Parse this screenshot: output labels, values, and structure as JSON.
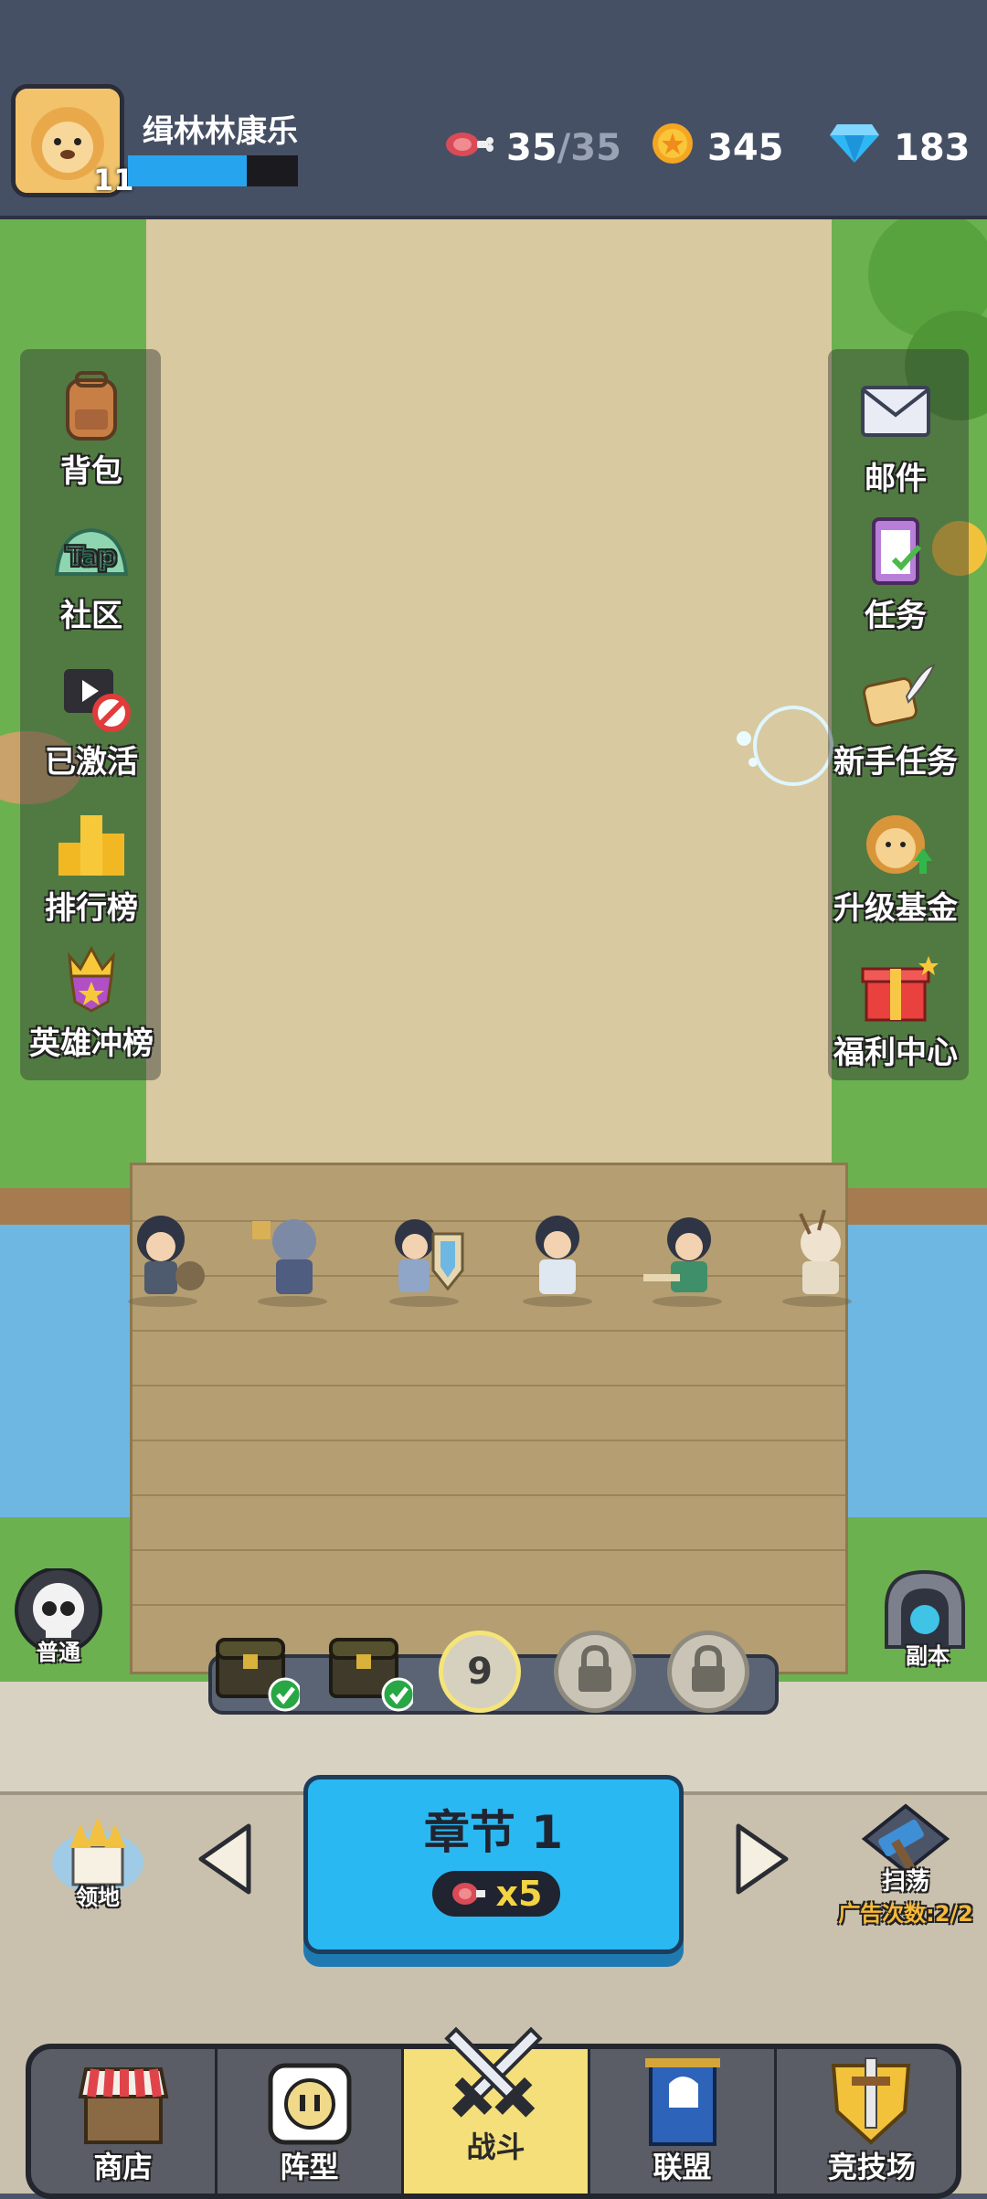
{
  "player": {
    "name": "缉林林康乐",
    "level": "11",
    "xp_fraction": 0.7
  },
  "resources": {
    "stamina": {
      "current": "35",
      "separator": "/",
      "max": "35",
      "icon": "meat-icon"
    },
    "gold": {
      "value": "345",
      "icon": "gold-coin-icon"
    },
    "gems": {
      "value": "183",
      "icon": "diamond-icon"
    }
  },
  "left_menu": [
    {
      "label": "背包",
      "icon": "backpack-icon"
    },
    {
      "label": "社区",
      "icon": "tap-community-icon",
      "icon_text": "Tap"
    },
    {
      "label": "已激活",
      "icon": "video-blocked-icon"
    },
    {
      "label": "排行榜",
      "icon": "ranking-podium-icon"
    },
    {
      "label": "英雄冲榜",
      "icon": "crown-badge-icon"
    }
  ],
  "right_menu": [
    {
      "label": "邮件",
      "icon": "mail-icon"
    },
    {
      "label": "任务",
      "icon": "task-clipboard-icon"
    },
    {
      "label": "新手任务",
      "icon": "scroll-quill-icon"
    },
    {
      "label": "升级基金",
      "icon": "lion-fund-icon"
    },
    {
      "label": "福利中心",
      "icon": "gift-box-icon"
    }
  ],
  "difficulty": {
    "label": "普通",
    "icon": "skull-icon"
  },
  "dungeon": {
    "label": "副本",
    "icon": "portal-icon"
  },
  "stages": {
    "current": "9"
  },
  "territory": {
    "label": "领地",
    "icon": "castle-icon"
  },
  "chapter": {
    "title": "章节 1",
    "cost": "x5"
  },
  "sweep": {
    "label": "扫荡",
    "ads_label": "广告次数:2/2",
    "icon": "hammer-icon"
  },
  "nav": [
    {
      "label": "商店",
      "icon": "shop-icon"
    },
    {
      "label": "阵型",
      "icon": "formation-icon"
    },
    {
      "label": "战斗",
      "icon": "crossed-swords-icon"
    },
    {
      "label": "联盟",
      "icon": "alliance-banner-icon"
    },
    {
      "label": "竞技场",
      "icon": "arena-shield-icon"
    }
  ],
  "colors": {
    "accent_blue": "#2ab8f2",
    "gold_text": "#f4d443",
    "ads_text": "#f6b93b"
  }
}
